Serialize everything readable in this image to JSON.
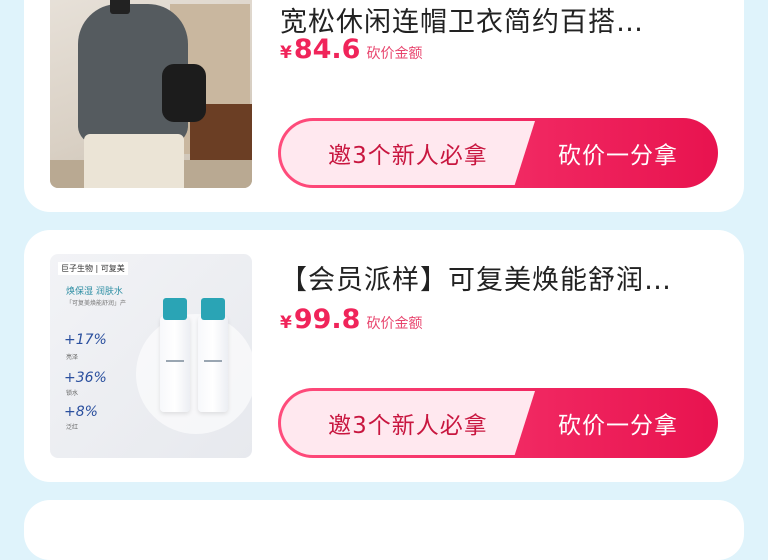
{
  "products": [
    {
      "title": "宽松休闲连帽卫衣简约百搭…",
      "currency": "¥",
      "price": "84.6",
      "price_label": "砍价金额",
      "invite_label": "邀3个新人必拿",
      "bargain_label": "砍价一分拿"
    },
    {
      "title": "【会员派样】可复美焕能舒润…",
      "currency": "¥",
      "price": "99.8",
      "price_label": "砍价金额",
      "invite_label": "邀3个新人必拿",
      "bargain_label": "砍价一分拿",
      "image_text": {
        "logo": "巨子生物 | 可复美",
        "tag": "焕保湿 润肤水",
        "sub": "「可复美焕能舒润」产",
        "stats": [
          "+17%",
          "+36%",
          "+8%"
        ],
        "stat_labels": [
          "亮泽",
          "锁水",
          "泛红"
        ]
      }
    }
  ]
}
